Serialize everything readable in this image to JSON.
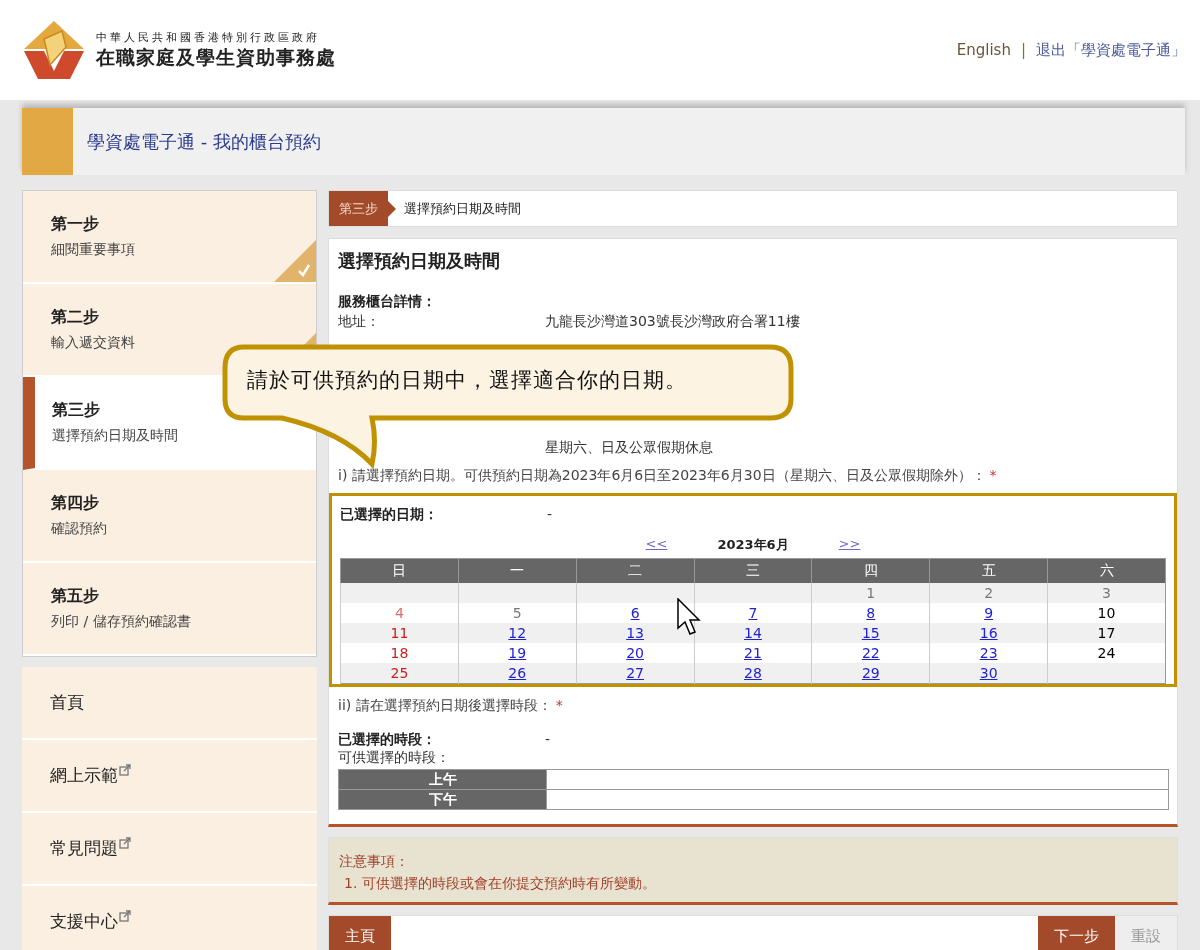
{
  "header": {
    "org_line": "中華人民共和國香港特別行政區政府",
    "org_name": "在職家庭及學生資助事務處",
    "links": [
      {
        "label": "English",
        "kind": "lang"
      },
      {
        "label": "退出「學資處電子通」",
        "kind": "logout"
      }
    ],
    "separator": "|"
  },
  "title_bar": {
    "title": "學資處電子通 - 我的櫃台預約"
  },
  "steps": [
    {
      "step": "第一步",
      "label": "細閱重要事項",
      "selected": false,
      "done": true
    },
    {
      "step": "第二步",
      "label": "輸入遞交資料",
      "selected": false,
      "done": true
    },
    {
      "step": "第三步",
      "label": "選擇預約日期及時間",
      "selected": true,
      "done": false
    },
    {
      "step": "第四步",
      "label": "確認預約",
      "selected": false,
      "done": false
    },
    {
      "step": "第五步",
      "label": "列印 / 儲存預約確認書",
      "selected": false,
      "done": false
    }
  ],
  "nav": [
    {
      "label": "首頁",
      "external": false
    },
    {
      "label": "網上示範",
      "external": true
    },
    {
      "label": "常見問題",
      "external": true
    },
    {
      "label": "支援中心",
      "external": true
    }
  ],
  "breadcrumb": {
    "step": "第三步",
    "title": "選擇預約日期及時間"
  },
  "main": {
    "heading": "選擇預約日期及時間",
    "details_heading": "服務櫃台詳情：",
    "info_rows": [
      {
        "label": "地址：",
        "value": "九龍長沙灣道303號長沙灣政府合署11樓"
      },
      {
        "value": "星期六、日及公眾假期休息"
      }
    ],
    "date_prompt": "i) 請選擇預約日期。可供預約日期為2023年6月6日至2023年6月30日（星期六、日及公眾假期除外）：",
    "required_mark": "*",
    "calendar": {
      "selected_label": "已選擇的日期：",
      "selected_value": "-",
      "prev": "<<",
      "month": "2023年6月",
      "next": ">>",
      "weekdays": [
        "日",
        "一",
        "二",
        "三",
        "四",
        "五",
        "六"
      ],
      "weeks": [
        [
          {
            "kind": "blank"
          },
          {
            "kind": "blank"
          },
          {
            "kind": "blank"
          },
          {
            "kind": "blank"
          },
          {
            "day": "1",
            "kind": "past"
          },
          {
            "day": "2",
            "kind": "past"
          },
          {
            "day": "3",
            "kind": "past"
          }
        ],
        [
          {
            "day": "4",
            "kind": "pastsunday"
          },
          {
            "day": "5",
            "kind": "past"
          },
          {
            "day": "6",
            "kind": "open"
          },
          {
            "day": "7",
            "kind": "open"
          },
          {
            "day": "8",
            "kind": "open"
          },
          {
            "day": "9",
            "kind": "open"
          },
          {
            "day": "10",
            "kind": "saturday"
          }
        ],
        [
          {
            "day": "11",
            "kind": "sunday"
          },
          {
            "day": "12",
            "kind": "open"
          },
          {
            "day": "13",
            "kind": "open"
          },
          {
            "day": "14",
            "kind": "open"
          },
          {
            "day": "15",
            "kind": "open"
          },
          {
            "day": "16",
            "kind": "open"
          },
          {
            "day": "17",
            "kind": "saturday"
          }
        ],
        [
          {
            "day": "18",
            "kind": "sunday"
          },
          {
            "day": "19",
            "kind": "open"
          },
          {
            "day": "20",
            "kind": "open"
          },
          {
            "day": "21",
            "kind": "open"
          },
          {
            "day": "22",
            "kind": "open"
          },
          {
            "day": "23",
            "kind": "open"
          },
          {
            "day": "24",
            "kind": "saturday"
          }
        ],
        [
          {
            "day": "25",
            "kind": "sunday"
          },
          {
            "day": "26",
            "kind": "open"
          },
          {
            "day": "27",
            "kind": "open"
          },
          {
            "day": "28",
            "kind": "open"
          },
          {
            "day": "29",
            "kind": "open"
          },
          {
            "day": "30",
            "kind": "open"
          },
          {
            "kind": "blank"
          }
        ]
      ]
    },
    "time_prompt": "ii) 請在選擇預約日期後選擇時段：",
    "time_selected_label": "已選擇的時段：",
    "time_selected_value": "-",
    "time_available_label": "可供選擇的時段：",
    "periods": [
      "上午",
      "下午"
    ]
  },
  "notice": {
    "title": "注意事項：",
    "items": [
      "1. 可供選擇的時段或會在你提交預約時有所變動。"
    ]
  },
  "footer_buttons": [
    {
      "label": "主頁",
      "kind": "primary"
    },
    {
      "label": "下一步",
      "kind": "primary"
    },
    {
      "label": "重設",
      "kind": "secondary"
    }
  ],
  "callout": {
    "text": "請於可供預約的日期中，選擇適合你的日期。"
  }
}
